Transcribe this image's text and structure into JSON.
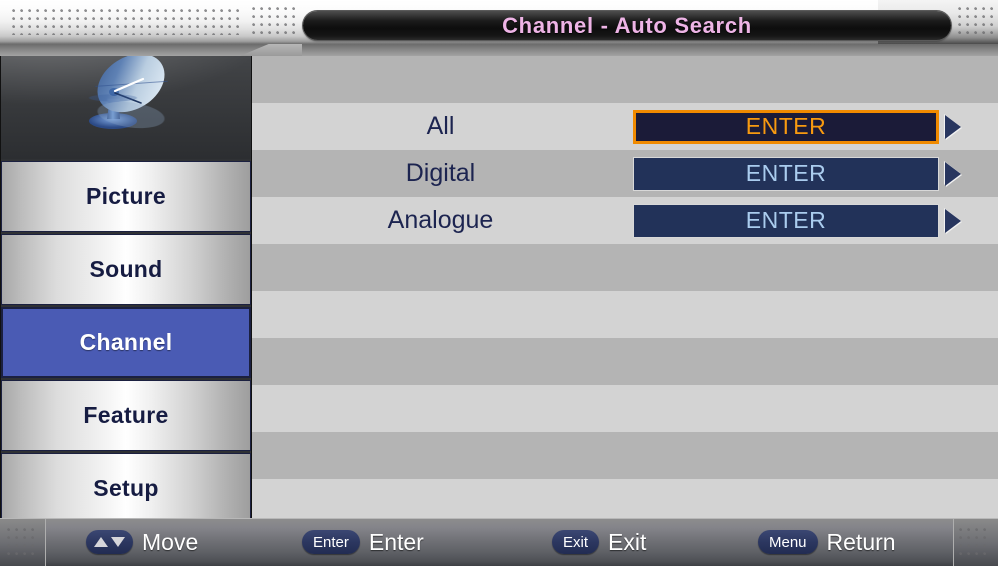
{
  "header": {
    "title": "Channel - Auto Search",
    "title_color": "#eeb4e6"
  },
  "sidebar": {
    "icon": "satellite-dish-icon",
    "items": [
      {
        "label": "Picture",
        "selected": false
      },
      {
        "label": "Sound",
        "selected": false
      },
      {
        "label": "Channel",
        "selected": true
      },
      {
        "label": "Feature",
        "selected": false
      },
      {
        "label": "Setup",
        "selected": false
      }
    ],
    "selected_color": "#4a5bb4"
  },
  "main": {
    "rows": [
      {
        "label": "All",
        "value": "ENTER",
        "focused": true,
        "has_arrow": true
      },
      {
        "label": "Digital",
        "value": "ENTER",
        "focused": false,
        "has_arrow": true
      },
      {
        "label": "Analogue",
        "value": "ENTER",
        "focused": false,
        "has_arrow": true
      }
    ],
    "empty_row_count": 7,
    "focus_border_color": "#f08a00",
    "focus_text_color": "#f89a10",
    "button_color": "#223259",
    "button_text_color": "#aaccee"
  },
  "footer": {
    "hints": [
      {
        "key": "up-down-arrows",
        "key_label": "",
        "action": "Move"
      },
      {
        "key": "enter-key",
        "key_label": "Enter",
        "action": "Enter"
      },
      {
        "key": "exit-key",
        "key_label": "Exit",
        "action": "Exit"
      },
      {
        "key": "menu-key",
        "key_label": "Menu",
        "action": "Return"
      }
    ]
  }
}
